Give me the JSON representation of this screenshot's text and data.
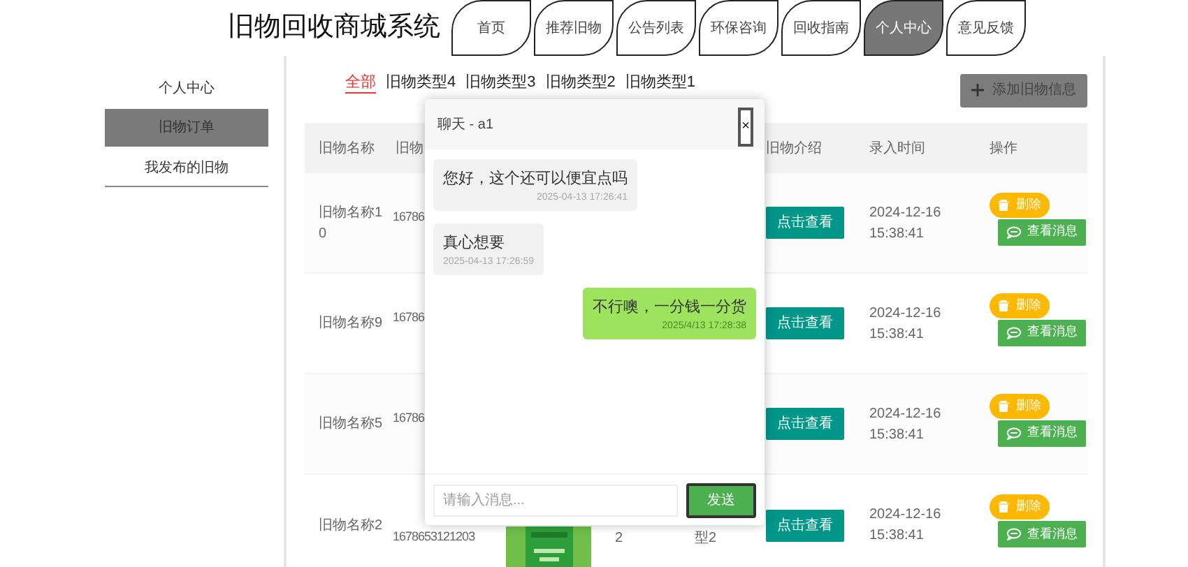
{
  "header": {
    "title": "旧物回收商城系统",
    "nav": [
      {
        "label": "首页",
        "selected": false
      },
      {
        "label": "推荐旧物",
        "selected": false
      },
      {
        "label": "公告列表",
        "selected": false
      },
      {
        "label": "环保咨询",
        "selected": false
      },
      {
        "label": "回收指南",
        "selected": false
      },
      {
        "label": "个人中心",
        "selected": true
      },
      {
        "label": "意见反馈",
        "selected": false
      }
    ]
  },
  "sidebar": {
    "items": [
      {
        "label": "个人中心",
        "selected": false
      },
      {
        "label": "旧物订单",
        "selected": true
      },
      {
        "label": "我发布的旧物",
        "selected": false
      }
    ]
  },
  "filters": [
    {
      "label": "全部",
      "selected": true
    },
    {
      "label": "旧物类型4",
      "selected": false
    },
    {
      "label": "旧物类型3",
      "selected": false
    },
    {
      "label": "旧物类型2",
      "selected": false
    },
    {
      "label": "旧物类型1",
      "selected": false
    }
  ],
  "add_button": "添加旧物信息",
  "table": {
    "columns": [
      {
        "label": "旧物名称"
      },
      {
        "label": "旧物"
      },
      {
        "label": "旧物介绍"
      },
      {
        "label": "录入时间"
      },
      {
        "label": "操作"
      }
    ],
    "rows": [
      {
        "name": "旧物名称10",
        "code": "16786",
        "intro_button": "点击查看",
        "time": "2024-12-16 15:38:41",
        "delete": "删除",
        "message": "查看消息"
      },
      {
        "name": "旧物名称9",
        "code": "16786",
        "intro_button": "点击查看",
        "time": "2024-12-16 15:38:41",
        "delete": "删除",
        "message": "查看消息"
      },
      {
        "name": "旧物名称5",
        "code": "16786",
        "intro_button": "点击查看",
        "time": "2024-12-16 15:38:41",
        "delete": "删除",
        "message": "查看消息"
      },
      {
        "name": "旧物名称2",
        "code": "1678653121203",
        "column_4": "2",
        "column_5": "型2",
        "intro_button": "点击查看",
        "time": "2024-12-16 15:38:41",
        "delete": "删除",
        "message": "查看消息"
      }
    ]
  },
  "chat": {
    "title": "聊天 - a1",
    "close": "×",
    "messages": [
      {
        "kind": "received",
        "text": "您好，这个还可以便宜点吗",
        "time": "2025-04-13 17:26:41"
      },
      {
        "kind": "received",
        "text": "真心想要",
        "time": "2025-04-13 17:26:59"
      },
      {
        "kind": "sent",
        "text": "不行噢，一分钱一分货",
        "time": "2025/4/13 17:28:38"
      }
    ],
    "input": {
      "placeholder": "请输入消息..."
    },
    "send": "发送"
  }
}
